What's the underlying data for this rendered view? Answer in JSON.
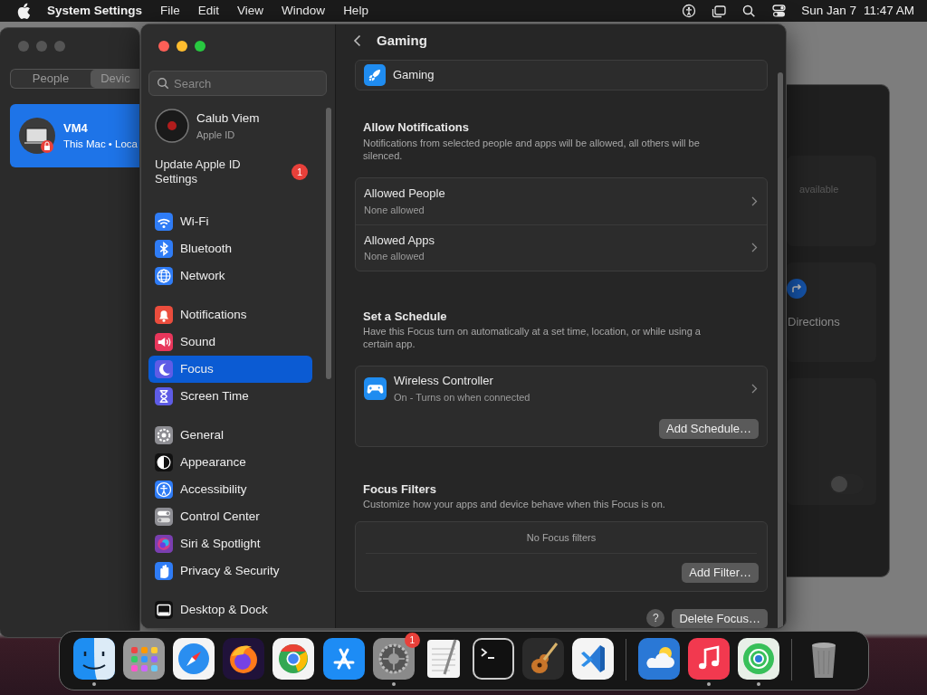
{
  "menu_bar": {
    "app": "System Settings",
    "menus": [
      "File",
      "Edit",
      "View",
      "Window",
      "Help"
    ],
    "date": "Sun Jan 7",
    "time": "11:47 AM"
  },
  "back_window": {
    "segments": [
      {
        "label": "People",
        "selected": false
      },
      {
        "label": "Devic",
        "selected": true
      }
    ],
    "device": {
      "name": "VM4",
      "detail": "This Mac • Loca",
      "selected": true
    }
  },
  "right_window": {
    "status": "available",
    "action": "Directions",
    "toggle_on": false
  },
  "settings_window": {
    "search_placeholder": "Search",
    "account": {
      "name": "Calub Viem",
      "subtitle": "Apple ID"
    },
    "update": {
      "label": "Update Apple ID Settings",
      "badge": "1"
    },
    "sidebar_groups": [
      {
        "items": [
          {
            "label": "Wi-Fi",
            "kind": "wifi",
            "color": "#2f7cf6",
            "selected": false
          },
          {
            "label": "Bluetooth",
            "kind": "bluetooth",
            "color": "#2f7cf6",
            "selected": false
          },
          {
            "label": "Network",
            "kind": "globe",
            "color": "#2f7cf6",
            "selected": false
          }
        ]
      },
      {
        "items": [
          {
            "label": "Notifications",
            "kind": "bell",
            "color": "#eb4d3d",
            "selected": false
          },
          {
            "label": "Sound",
            "kind": "speaker",
            "color": "#e8365b",
            "selected": false
          },
          {
            "label": "Focus",
            "kind": "moon",
            "color": "#5e5ce6",
            "selected": true
          },
          {
            "label": "Screen Time",
            "kind": "hourglass",
            "color": "#5e5ce6",
            "selected": false
          }
        ]
      },
      {
        "items": [
          {
            "label": "General",
            "kind": "gear",
            "color": "#8e8e93",
            "selected": false
          },
          {
            "label": "Appearance",
            "kind": "contrast",
            "color": "#111111",
            "selected": false
          },
          {
            "label": "Accessibility",
            "kind": "person",
            "color": "#2f7cf6",
            "selected": false
          },
          {
            "label": "Control Center",
            "kind": "toggles",
            "color": "#8e8e93",
            "selected": false
          },
          {
            "label": "Siri & Spotlight",
            "kind": "orb",
            "color": "#7a3fb0",
            "selected": false
          },
          {
            "label": "Privacy & Security",
            "kind": "hand",
            "color": "#2f7cf6",
            "selected": false
          }
        ]
      },
      {
        "items": [
          {
            "label": "Desktop & Dock",
            "kind": "dock",
            "color": "#111111",
            "selected": false
          }
        ]
      }
    ],
    "page": {
      "title": "Gaming",
      "focus_name": "Gaming",
      "allow_notifications": {
        "title": "Allow Notifications",
        "description": "Notifications from selected people and apps will be allowed, all others will be silenced.",
        "rows": [
          {
            "title": "Allowed People",
            "subtitle": "None allowed"
          },
          {
            "title": "Allowed Apps",
            "subtitle": "None allowed"
          }
        ]
      },
      "schedule": {
        "title": "Set a Schedule",
        "description": "Have this Focus turn on automatically at a set time, location, or while using a certain app.",
        "items": [
          {
            "title": "Wireless Controller",
            "subtitle": "On - Turns on when connected"
          }
        ],
        "button": "Add Schedule…"
      },
      "filters": {
        "title": "Focus Filters",
        "description": "Customize how your apps and device behave when this Focus is on.",
        "empty": "No Focus filters",
        "button": "Add Filter…"
      },
      "footer": {
        "help": "?",
        "button": "Delete Focus…"
      }
    }
  },
  "dock": {
    "groups": [
      {
        "items": [
          {
            "kind": "finder",
            "running": true
          },
          {
            "kind": "launchpad",
            "running": false
          },
          {
            "kind": "safari",
            "running": false
          },
          {
            "kind": "firefox",
            "running": false
          },
          {
            "kind": "chrome",
            "running": false
          },
          {
            "kind": "appstore",
            "running": false
          },
          {
            "kind": "settings",
            "running": true,
            "badge": "1"
          },
          {
            "kind": "notepad",
            "running": false
          },
          {
            "kind": "terminal",
            "running": false
          },
          {
            "kind": "guitar",
            "running": false
          },
          {
            "kind": "code",
            "running": false
          }
        ]
      },
      {
        "items": [
          {
            "kind": "weather",
            "running": false
          },
          {
            "kind": "music",
            "running": true
          },
          {
            "kind": "findmy",
            "running": true
          }
        ]
      },
      {
        "items": [
          {
            "kind": "trash",
            "running": false
          }
        ]
      }
    ]
  }
}
